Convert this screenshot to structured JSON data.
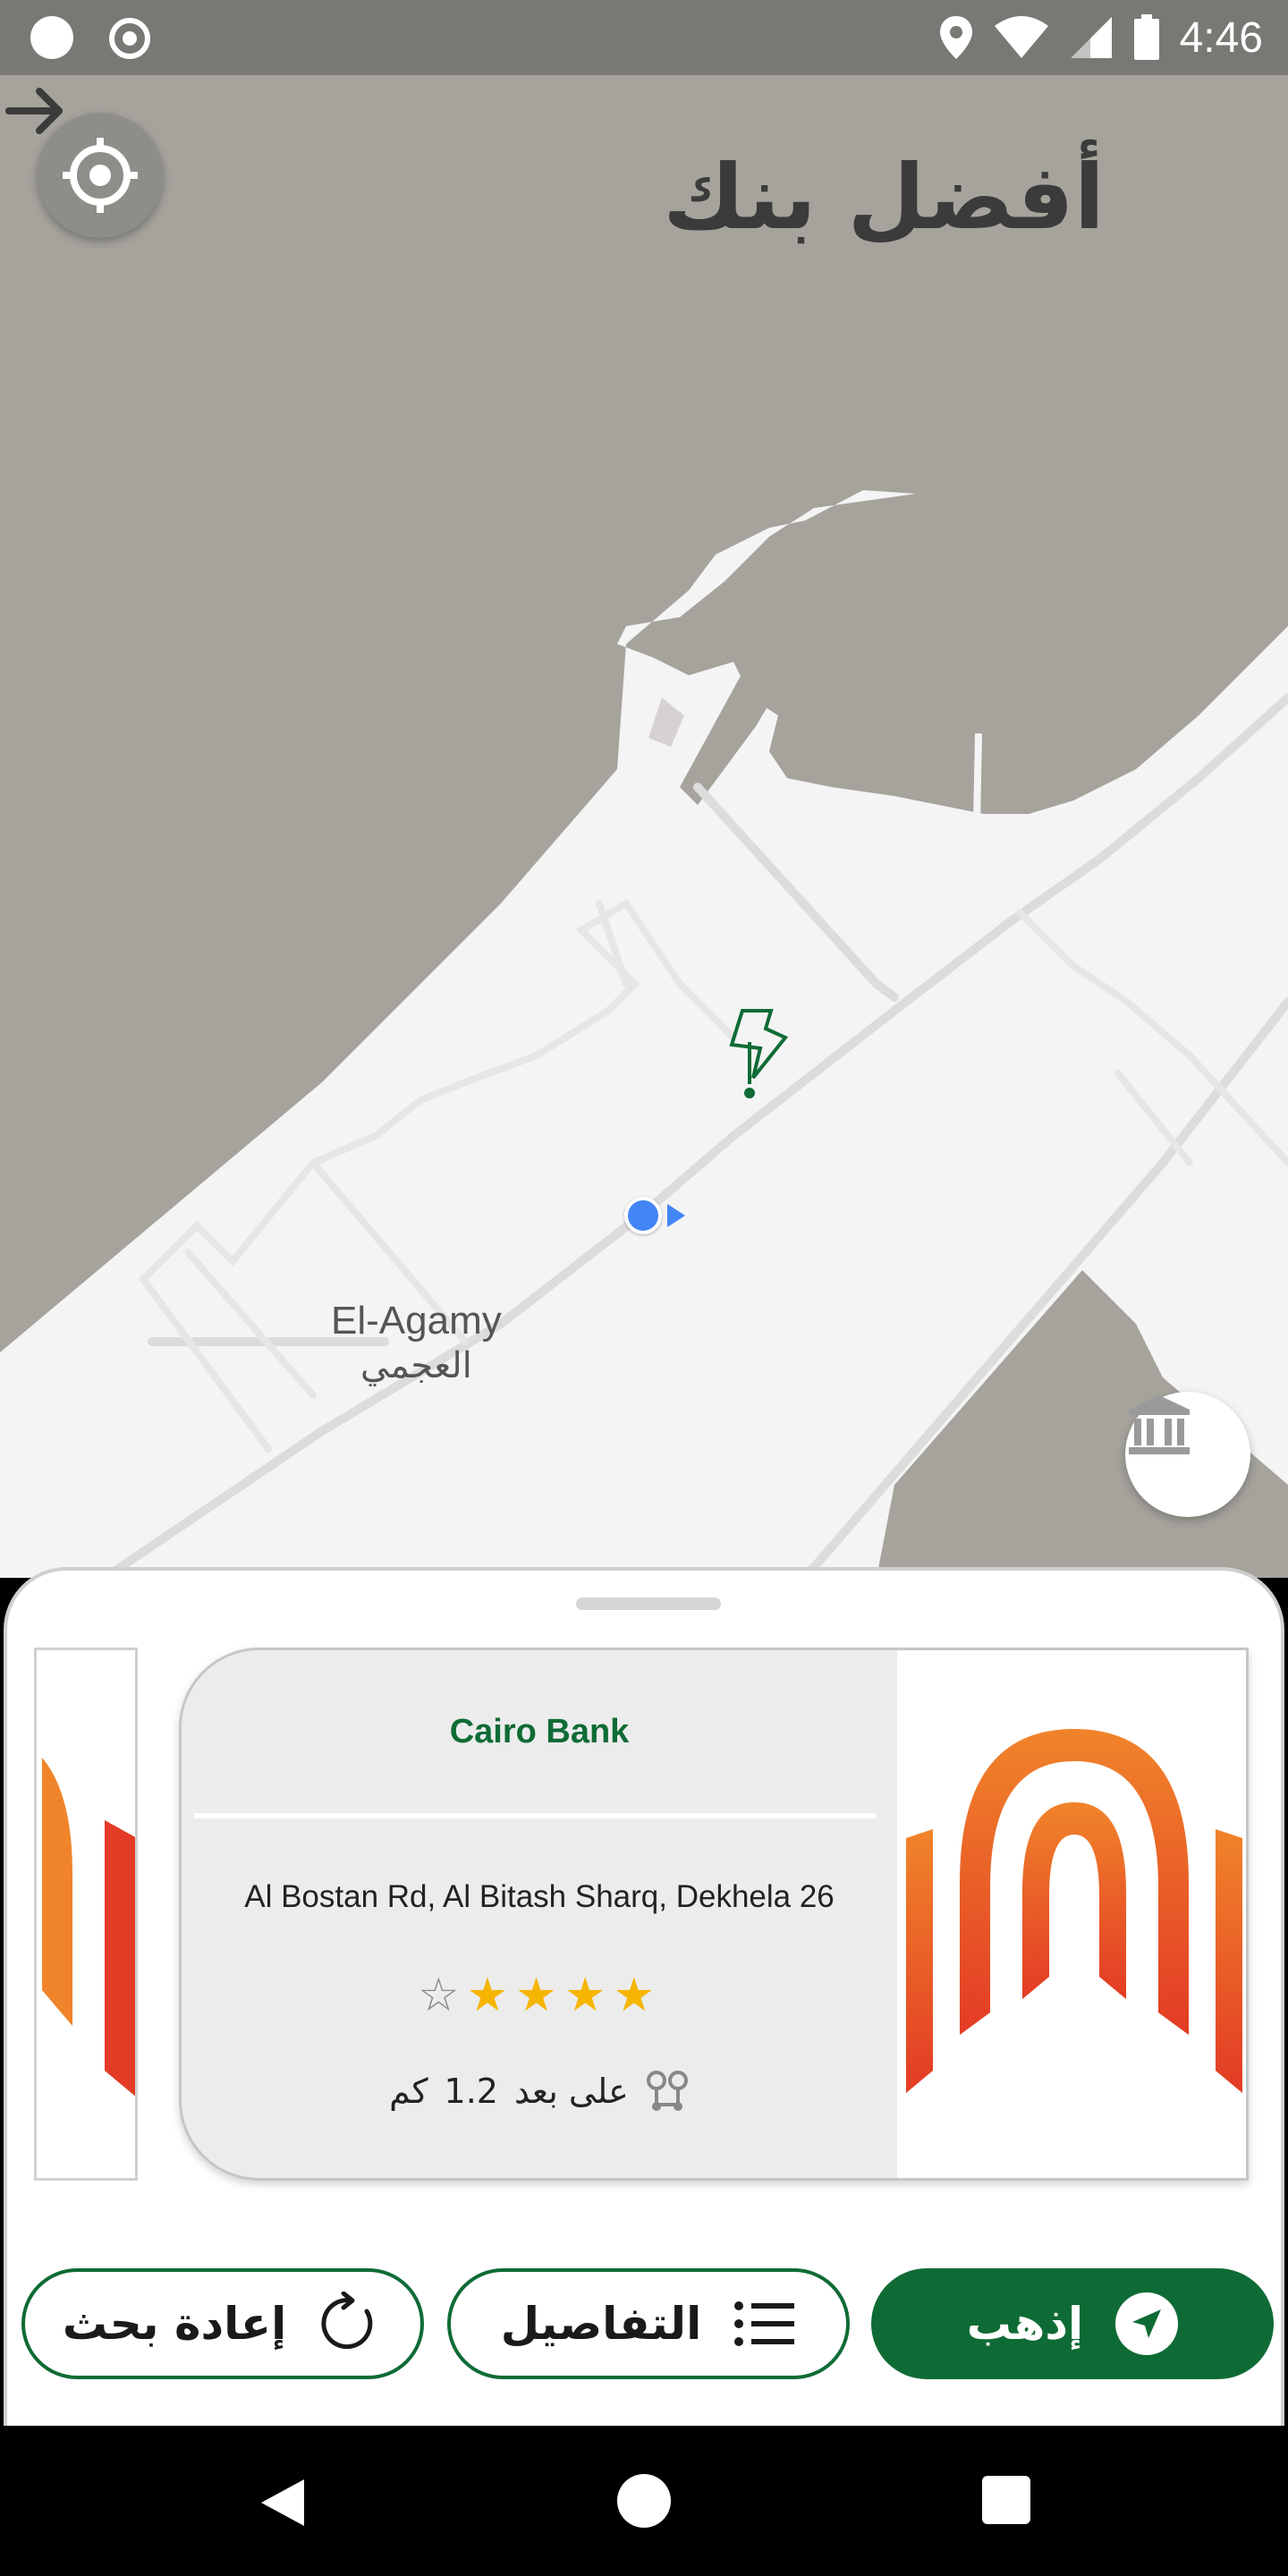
{
  "status_bar": {
    "time": "4:46",
    "icons": [
      "notification-dot-icon",
      "record-icon",
      "location-pin-icon",
      "wifi-icon",
      "signal-icon",
      "battery-icon"
    ]
  },
  "header": {
    "title": "أفضل بنك",
    "back_icon": "arrow-right-icon"
  },
  "map": {
    "place_label_en": "El-Agamy",
    "place_label_ar": "العجمي",
    "marker_icon": "bank-pin-icon",
    "locate_button_icon": "crosshair-icon",
    "bank_fab_icon": "bank-icon"
  },
  "sheet": {
    "card": {
      "bank_name": "Cairo Bank",
      "address": "Al Bostan Rd, Al Bitash Sharq, Dekhela 26",
      "rating": 4,
      "rating_max": 5,
      "distance_prefix": "على بعد",
      "distance_value": "1.2",
      "distance_unit": "كم",
      "distance_icon": "route-pins-icon"
    }
  },
  "actions": {
    "go_label": "إذهب",
    "details_label": "التفاصيل",
    "research_label": "إعادة بحث"
  },
  "colors": {
    "brand_green": "#0f6b35",
    "star": "#f6b500",
    "logo_orange": "#f0842a",
    "logo_red": "#e33b25",
    "map_water": "#a5a39c",
    "map_land": "#f4f4f4"
  }
}
